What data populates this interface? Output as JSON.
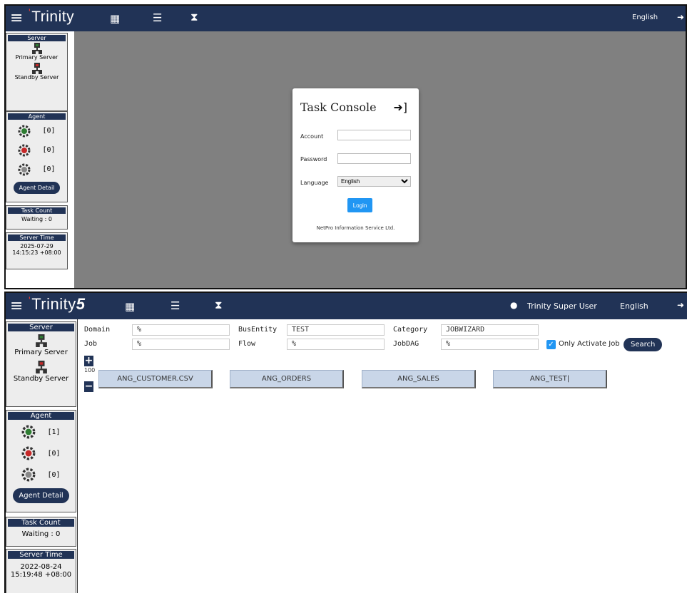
{
  "top_window": {
    "brand": "Trinity",
    "nav_icons": [
      "grid-icon",
      "list-icon",
      "hourglass-icon"
    ],
    "language": "English",
    "sidebar": {
      "server_header": "Server",
      "primary_server": "Primary Server",
      "standby_server": "Standby Server",
      "agent_header": "Agent",
      "agent_counts": [
        "[0]",
        "[0]",
        "[0]"
      ],
      "agent_detail_button": "Agent Detail",
      "task_count_header": "Task Count",
      "waiting": "Waiting : 0",
      "server_time_header": "Server Time",
      "server_date": "2025-07-29",
      "server_clock": "14:15:23 +08:00"
    },
    "login": {
      "title": "Task Console",
      "account_label": "Account",
      "password_label": "Password",
      "language_label": "Language",
      "language_value": "English",
      "login_button": "Login",
      "footer": "NetPro Information Service Ltd."
    }
  },
  "bottom_window": {
    "brand": "Trinity",
    "brand_suffix": "5",
    "nav_icons": [
      "grid-icon",
      "list-icon",
      "hourglass-icon"
    ],
    "user_name": "Trinity Super User",
    "language": "English",
    "sidebar": {
      "server_header": "Server",
      "primary_server": "Primary Server",
      "standby_server": "Standby Server",
      "agent_header": "Agent",
      "agent_counts": [
        "[1]",
        "[0]",
        "[0]"
      ],
      "agent_detail_button": "Agent Detail",
      "task_count_header": "Task Count",
      "waiting": "Waiting : 0",
      "server_time_header": "Server Time",
      "server_date": "2022-08-24",
      "server_clock": "15:19:48 +08:00"
    },
    "filters": {
      "domain_label": "Domain",
      "domain_value": "%",
      "job_label": "Job",
      "job_value": "%",
      "busentity_label": "BusEntity",
      "busentity_value": "TEST",
      "flow_label": "Flow",
      "flow_value": "%",
      "category_label": "Category",
      "category_value": "JOBWIZARD",
      "jobdag_label": "JobDAG",
      "jobdag_value": "%",
      "only_activate_label": "Only Activate Job",
      "search_button": "Search"
    },
    "zoom_level": "100",
    "job_tabs": [
      "ANG_CUSTOMER.CSV",
      "ANG_ORDERS",
      "ANG_SALES",
      "ANG_TEST|"
    ]
  },
  "colors": {
    "navbar": "#213356",
    "workspace_gray": "#808080",
    "login_button": "#2196f3",
    "job_tab": "#c9d6e8",
    "agent_green": "#2e7d32",
    "agent_red": "#c62828",
    "brand_mark": "#e53935"
  }
}
